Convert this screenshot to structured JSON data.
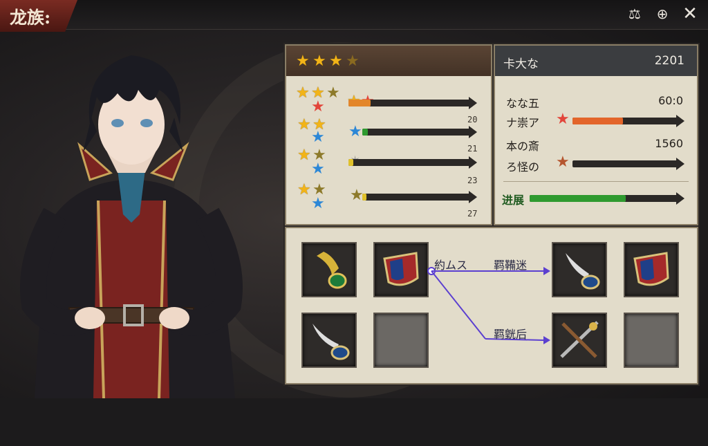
{
  "title": "龙族:",
  "top_icons": {
    "scale": "scale-icon",
    "target": "target-icon",
    "close": "close-icon"
  },
  "left_panel": {
    "header_stars": 4,
    "rows": [
      {
        "progress": 0.18,
        "count": ""
      },
      {
        "progress": 0.05,
        "count": "20"
      },
      {
        "progress": 0.04,
        "count": "21"
      },
      {
        "progress": 0.04,
        "count": "23"
      },
      {
        "last_count": "27"
      }
    ]
  },
  "right_panel": {
    "header_name": "卡大な",
    "header_value": "2201",
    "stats": [
      {
        "label": "なな五",
        "value": "60:0"
      },
      {
        "label": "ナ崇ア",
        "value": "",
        "progress": 0.48
      },
      {
        "label": "本の斎",
        "value": "1560"
      },
      {
        "label": "ろ怪の",
        "value": "",
        "progress": 0.0
      }
    ],
    "progress_label": "进展",
    "progress": 0.65
  },
  "craft": {
    "source_label": "約ムス",
    "target_top_label": "羁鞴迷",
    "target_bottom_label": "羁皝后"
  },
  "colors": {
    "accent": "#7a2b22",
    "panel": "#e2dcca",
    "link": "#5b3fd0",
    "bar_fill": "#2f9a2f"
  }
}
